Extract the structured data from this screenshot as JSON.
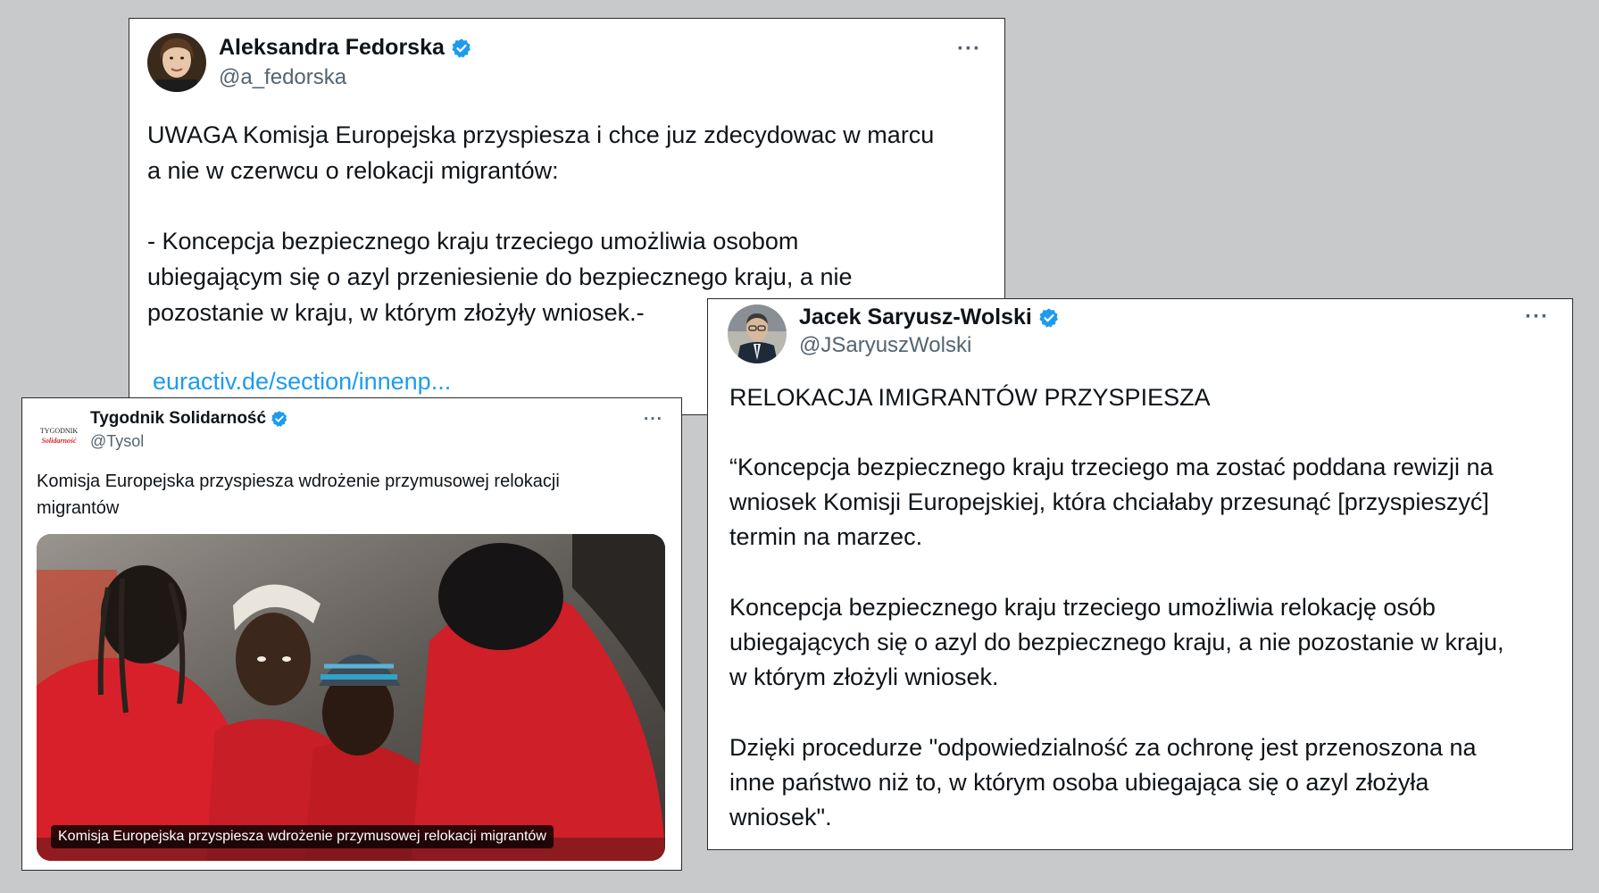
{
  "colors": {
    "background": "#c8c9cb",
    "card": "#ffffff",
    "text": "#0f1419",
    "secondary": "#536471",
    "link": "#1d9bf0",
    "verified": "#1d9bf0",
    "logo_red": "#d6262c"
  },
  "tweet_fedorska": {
    "author_name": "Aleksandra Fedorska",
    "handle": "@a_fedorska",
    "verified_icon": "verified-badge-icon",
    "more_icon": "more-options-icon",
    "more_label": "···",
    "text_line1": "UWAGA Komisja Europejska przyspiesza i chce juz zdecydowac w  marcu",
    "text_line2": "a nie w czerwcu o relokacji migrantów:",
    "text_line3": "- Koncepcja bezpiecznego kraju trzeciego umożliwia osobom",
    "text_line4": "ubiegającym się o azyl przeniesienie do bezpiecznego kraju, a nie",
    "text_line5": "pozostanie w kraju, w którym złożyły wniosek.-",
    "link": "euractiv.de/section/innenp..."
  },
  "tweet_tysol": {
    "author_name": "Tygodnik Solidarność",
    "handle": "@Tysol",
    "logo_text": "TYGODNIK",
    "logo_subtext": "Solidarność",
    "verified_icon": "verified-badge-icon",
    "more_icon": "more-options-icon",
    "more_label": "···",
    "text_line1": "Komisja Europejska przyspiesza wdrożenie przymusowej relokacji",
    "text_line2": "migrantów",
    "media_caption": "Komisja Europejska przyspiesza wdrożenie przymusowej relokacji migrantów"
  },
  "tweet_saryusz": {
    "author_name": "Jacek Saryusz-Wolski",
    "handle": "@JSaryuszWolski",
    "verified_icon": "verified-badge-icon",
    "more_icon": "more-options-icon",
    "more_label": "···",
    "text_line1": "RELOKACJA IMIGRANTÓW PRZYSPIESZA",
    "text_line2": "“Koncepcja bezpiecznego kraju trzeciego ma zostać poddana rewizji na",
    "text_line3": "wniosek Komisji Europejskiej, która chciałaby przesunąć [przyspieszyć]",
    "text_line4": "termin na marzec.",
    "text_line5": "Koncepcja bezpiecznego kraju trzeciego umożliwia relokację osób",
    "text_line6": "ubiegających się o azyl do bezpiecznego kraju, a nie pozostanie w kraju,",
    "text_line7": "w którym złożyli wniosek.",
    "text_line8": "Dzięki procedurze \"odpowiedzialność za ochronę jest przenoszona na",
    "text_line9": "inne państwo niż to, w którym osoba ubiegająca się o azyl złożyła",
    "text_line10": "wniosek\"."
  }
}
